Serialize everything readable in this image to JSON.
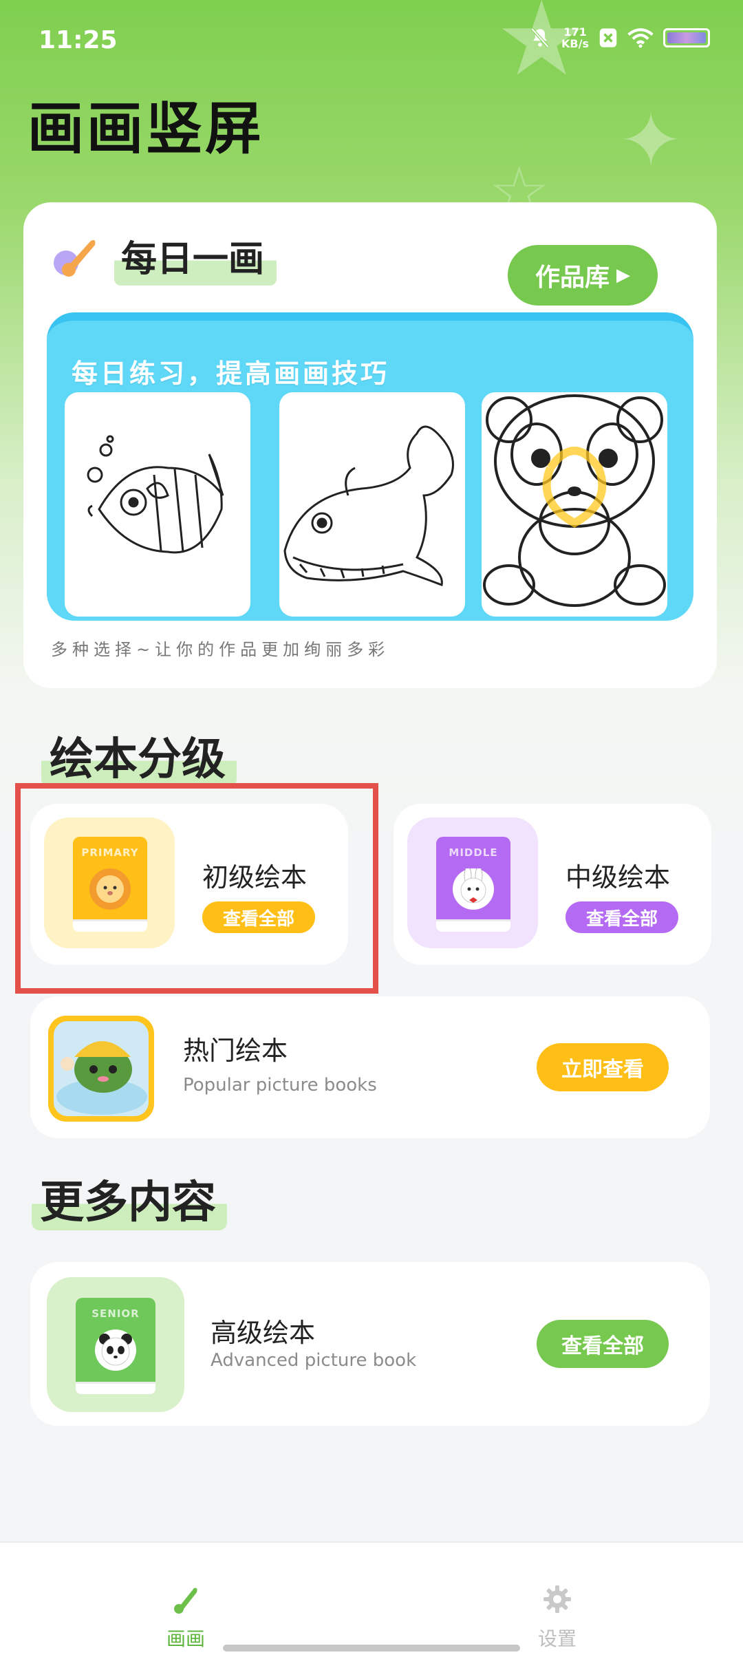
{
  "status_bar": {
    "time": "11:25",
    "net_speed_value": "171",
    "net_speed_unit": "KB/s"
  },
  "app_title": "画画竖屏",
  "daily": {
    "title": "每日一画",
    "works_button": "作品库",
    "slogan": "每日练习，提高画画技巧",
    "subtitle": "多种选择~让你的作品更加绚丽多彩",
    "samples": [
      "fish",
      "whale",
      "panda"
    ]
  },
  "grading": {
    "section_title": "绘本分级",
    "primary": {
      "book_label": "PRIMARY",
      "name": "初级绘本",
      "button": "查看全部"
    },
    "middle": {
      "book_label": "MIDDLE",
      "name": "中级绘本",
      "button": "查看全部"
    },
    "hot": {
      "name": "热门绘本",
      "subtitle": "Popular picture books",
      "button": "立即查看"
    }
  },
  "more": {
    "section_title": "更多内容",
    "senior": {
      "book_label": "SENIOR",
      "name": "高级绘本",
      "subtitle": "Advanced picture book",
      "button": "查看全部"
    }
  },
  "bottom_nav": {
    "items": [
      {
        "label": "画画",
        "icon": "brush-icon",
        "active": true
      },
      {
        "label": "设置",
        "icon": "gear-icon",
        "active": false
      }
    ]
  },
  "colors": {
    "green": "#76c84e",
    "yellow": "#ffbf17",
    "purple": "#b46af2",
    "highlight_red": "#e4514a",
    "sky_blue": "#5fd8f8"
  }
}
